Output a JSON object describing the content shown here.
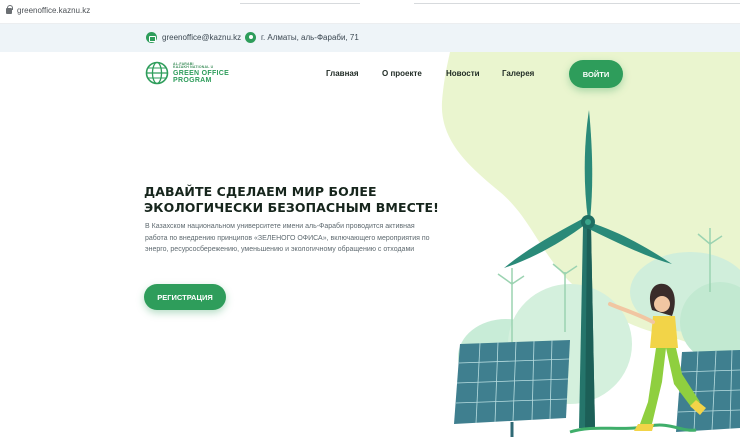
{
  "browser": {
    "url": "greenoffice.kaznu.kz"
  },
  "contacts": {
    "email": "greenoffice@kaznu.kz",
    "address": "г. Алматы, аль-Фараби, 71"
  },
  "logo": {
    "small_text": "AL-FARABI\nKAZAKH NATIONAL U",
    "line1": "GREEN OFFICE",
    "line2": "PROGRAM"
  },
  "nav": {
    "home": "Главная",
    "about": "О проекте",
    "news": "Новости",
    "gallery": "Галерея",
    "login": "ВОЙТИ"
  },
  "hero": {
    "title_line1": "ДАВАЙТЕ СДЕЛАЕМ МИР БОЛЕЕ",
    "title_line2": "ЭКОЛОГИЧЕСКИ БЕЗОПАСНЫМ ВМЕСТЕ!",
    "text": "В Казахском национальном университете имени аль-Фараби проводится активная работа по внедрению принципов «ЗЕЛЕНОГО ОФИСА», включающего мероприятия по энерго, ресурсосбережению, уменьшению и экологичному обращению с отходами",
    "register": "РЕГИСТРАЦИЯ"
  },
  "colors": {
    "brand_green": "#2e9d5b",
    "light_green": "#e9f4cf",
    "topbar": "#eef4f8"
  },
  "icons": {
    "lock": "lock-icon",
    "email": "email-icon",
    "location": "location-pin-icon",
    "logo": "globe-logo-icon"
  }
}
